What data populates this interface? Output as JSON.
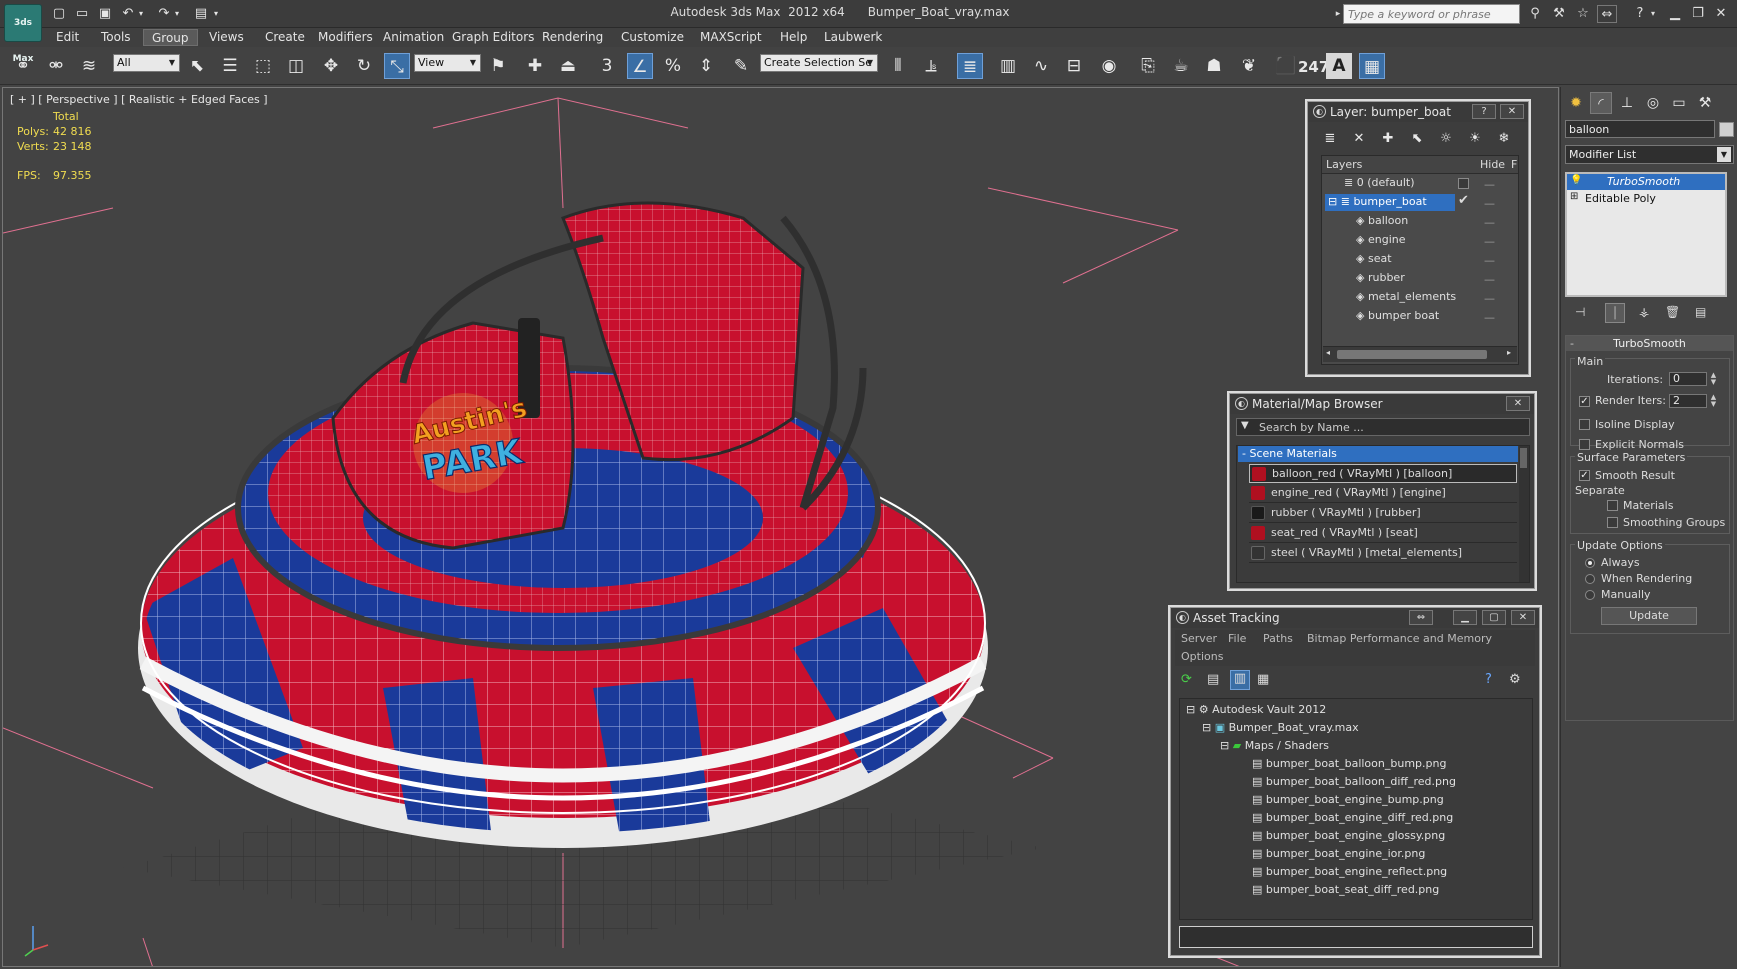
{
  "app": {
    "title": "Autodesk 3ds Max  2012 x64      Bumper_Boat_vray.max",
    "logo": "3ds Max",
    "search_placeholder": "Type a keyword or phrase"
  },
  "menu": [
    "Edit",
    "Tools",
    "Group",
    "Views",
    "Create",
    "Modifiers",
    "Animation",
    "Graph Editors",
    "Rendering",
    "Customize",
    "MAXScript",
    "Help",
    "Laubwerk"
  ],
  "menu_active": "Group",
  "toolbar": {
    "selection_filter": "All",
    "ref_coord": "View",
    "named_selection": "Create Selection Se",
    "counter": "247",
    "text_icon": "A"
  },
  "viewport": {
    "label": "[ + ] [ Perspective ] [ Realistic + Edged Faces ]",
    "stats": {
      "header": "Total",
      "polys_label": "Polys:",
      "polys": "42 816",
      "verts_label": "Verts:",
      "verts": "23 148",
      "fps_label": "FPS:",
      "fps": "97.355"
    },
    "logo_text_1": "Austin's",
    "logo_text_2": "PARK",
    "colors": {
      "background": "#434343",
      "boat_red": "#c8102e",
      "boat_blue": "#1a3a9a",
      "stat_yellow": "#f0dc50"
    }
  },
  "layer_window": {
    "title": "Layer: bumper_boat",
    "help": "?",
    "col_layers": "Layers",
    "col_hide": "Hide",
    "col_f": "F",
    "rows": [
      {
        "name": "0 (default)",
        "hide": "—",
        "selected": false
      },
      {
        "name": "bumper_boat",
        "hide": "—",
        "selected": true
      },
      {
        "name": "balloon",
        "hide": "—"
      },
      {
        "name": "engine",
        "hide": "—"
      },
      {
        "name": "seat",
        "hide": "—"
      },
      {
        "name": "rubber",
        "hide": "—"
      },
      {
        "name": "metal_elements",
        "hide": "—"
      },
      {
        "name": "bumper boat",
        "hide": "—"
      }
    ]
  },
  "material_browser": {
    "title": "Material/Map Browser",
    "search_placeholder": "Search by Name ...",
    "group": "- Scene Materials",
    "items": [
      "balloon_red  ( VRayMtl ) [balloon]",
      "engine_red  ( VRayMtl ) [engine]",
      "rubber  ( VRayMtl ) [rubber]",
      "seat_red  ( VRayMtl ) [seat]",
      "steel  ( VRayMtl ) [metal_elements]"
    ]
  },
  "asset_tracking": {
    "title": "Asset Tracking",
    "menu": [
      "Server",
      "File",
      "Paths",
      "Bitmap Performance and Memory"
    ],
    "menu2": [
      "Options"
    ],
    "vault": "Autodesk Vault 2012",
    "file": "Bumper_Boat_vray.max",
    "folder": "Maps / Shaders",
    "maps": [
      "bumper_boat_balloon_bump.png",
      "bumper_boat_balloon_diff_red.png",
      "bumper_boat_engine_bump.png",
      "bumper_boat_engine_diff_red.png",
      "bumper_boat_engine_glossy.png",
      "bumper_boat_engine_ior.png",
      "bumper_boat_engine_reflect.png",
      "bumper_boat_seat_diff_red.png"
    ]
  },
  "command_panel": {
    "object_name": "balloon",
    "modifier_list": "Modifier List",
    "stack": [
      "TurboSmooth",
      "Editable Poly"
    ],
    "rollout": "TurboSmooth",
    "main_group": "Main",
    "iterations_label": "Iterations:",
    "iterations": "0",
    "render_iters_label": "Render Iters:",
    "render_iters": "2",
    "isoline": "Isoline Display",
    "explicit": "Explicit Normals",
    "surface_group": "Surface Parameters",
    "smooth_result": "Smooth Result",
    "separate": "Separate",
    "materials": "Materials",
    "smoothing_groups": "Smoothing Groups",
    "update_group": "Update Options",
    "always": "Always",
    "when_rendering": "When Rendering",
    "manually": "Manually",
    "update_button": "Update"
  }
}
